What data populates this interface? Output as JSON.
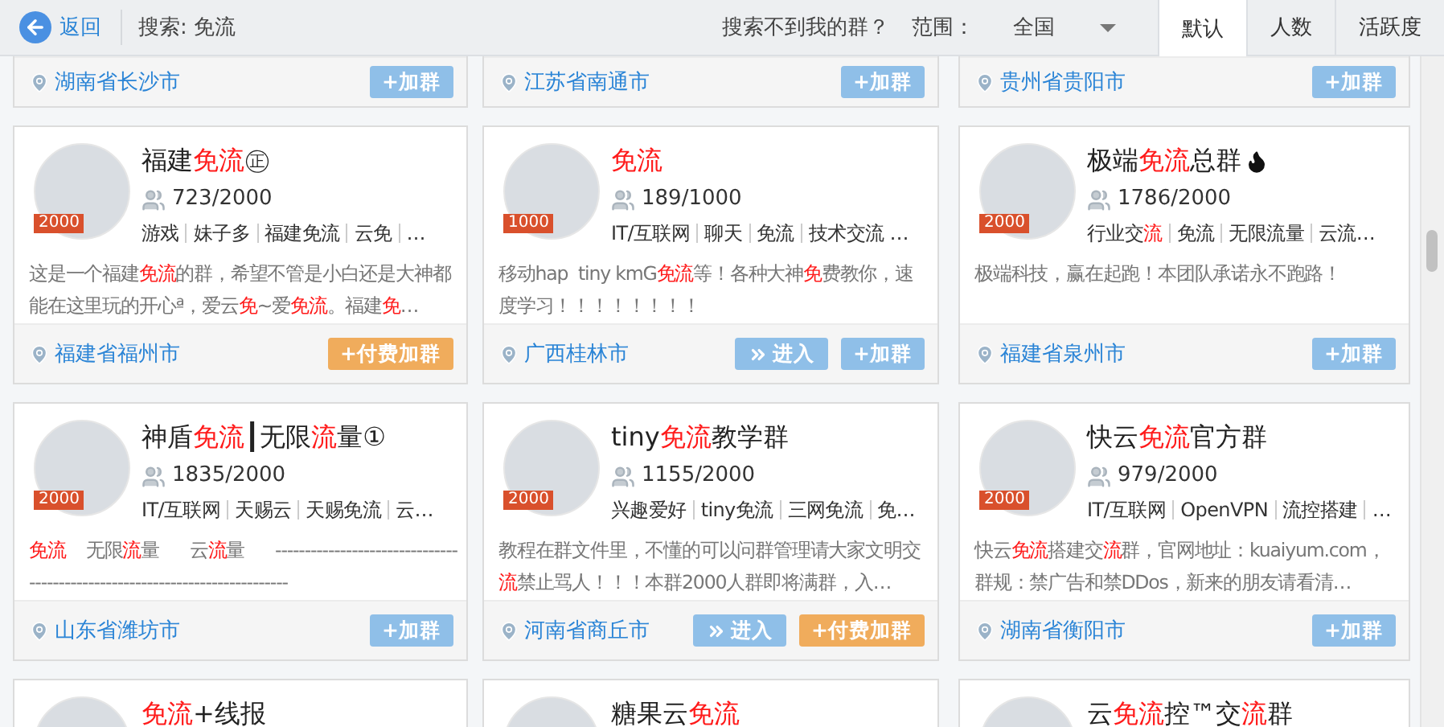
{
  "toolbar": {
    "back": "返回",
    "search": "搜索: 免流",
    "help": "搜索不到我的群？",
    "scope_label": "范围：",
    "scope_value": "全国",
    "tabs": [
      {
        "label": "默认",
        "selected": true
      },
      {
        "label": "人数",
        "selected": false
      },
      {
        "label": "活跃度",
        "selected": false
      }
    ]
  },
  "rows": [
    {
      "cards": [
        {
          "location": "湖南省长沙市",
          "buttons": [
            {
              "kind": "join",
              "label": "+加群"
            }
          ]
        },
        {
          "location": "江苏省南通市",
          "buttons": [
            {
              "kind": "join",
              "label": "+加群"
            }
          ]
        },
        {
          "location": "贵州省贵阳市",
          "buttons": [
            {
              "kind": "join",
              "label": "+加群"
            }
          ]
        }
      ]
    },
    {
      "cards": [
        {
          "title": "福建**免流**㊣",
          "hot": false,
          "badge": "2000",
          "members": "723/2000",
          "tags": [
            "游戏",
            "妹子多",
            "福建免流",
            "云免",
            "…"
          ],
          "description": "这是一个福建**免流**的群，希望不管是小白还是大神都能在这里玩的开心ª，爱云**免**~爱**免流**。福建**免**…",
          "location": "福建省福州市",
          "buttons": [
            {
              "kind": "paid",
              "label": "+付费加群"
            }
          ]
        },
        {
          "title": "**免流**",
          "hot": false,
          "badge": "1000",
          "members": "189/1000",
          "tags": [
            "IT/互联网",
            "聊天",
            "免流",
            "技术交流 …"
          ],
          "description": "移动hap  tiny kmG**免流**等！各种大神**免**费教你，速度学习！！！！！！！！",
          "location": "广西桂林市",
          "buttons": [
            {
              "kind": "enter",
              "label": "进入"
            },
            {
              "kind": "join",
              "label": "+加群"
            }
          ]
        },
        {
          "title": "极端**免流**总群",
          "hot": true,
          "badge": "2000",
          "members": "1786/2000",
          "tags": [
            "行业交**流**",
            "免流",
            "无限流量",
            "云流…"
          ],
          "description": "极端科技，赢在起跑！本团队承诺永不跑路！",
          "location": "福建省泉州市",
          "buttons": [
            {
              "kind": "join",
              "label": "+加群"
            }
          ]
        }
      ]
    },
    {
      "cards": [
        {
          "title": "神盾**免流**┃无限**流**量①",
          "hot": false,
          "badge": "2000",
          "members": "1835/2000",
          "tags": [
            "IT/互联网",
            "天赐云",
            "天赐免流",
            "云…"
          ],
          "description": "**免流**    无限**流**量      云**流**量      ---------------------------------------------------------------------------",
          "location": "山东省潍坊市",
          "buttons": [
            {
              "kind": "join",
              "label": "+加群"
            }
          ]
        },
        {
          "title": "tiny**免流**教学群",
          "hot": false,
          "badge": "2000",
          "members": "1155/2000",
          "tags": [
            "兴趣爱好",
            "tiny免流",
            "三网免流",
            "免…"
          ],
          "description": "教程在群文件里，不懂的可以问群管理请大家文明交**流**禁止骂人！！！本群2000人群即将满群，入…",
          "location": "河南省商丘市",
          "buttons": [
            {
              "kind": "enter",
              "label": "进入"
            },
            {
              "kind": "paid",
              "label": "+付费加群"
            }
          ]
        },
        {
          "title": "快云**免流**官方群",
          "hot": false,
          "badge": "2000",
          "members": "979/2000",
          "tags": [
            "IT/互联网",
            "OpenVPN",
            "流控搭建",
            "…"
          ],
          "description": "快云**免流**搭建交**流**群，官网地址：kuaiyum.com，群规：禁广告和禁DDos，新来的朋友请看清…",
          "location": "湖南省衡阳市",
          "buttons": [
            {
              "kind": "join",
              "label": "+加群"
            }
          ]
        }
      ]
    },
    {
      "cards": [
        {
          "title": "**免流**+线报",
          "hot": false
        },
        {
          "title": "糖果云**免流**",
          "hot": false
        },
        {
          "title": "云**免流**控™交**流**群",
          "hot": false
        }
      ]
    }
  ]
}
